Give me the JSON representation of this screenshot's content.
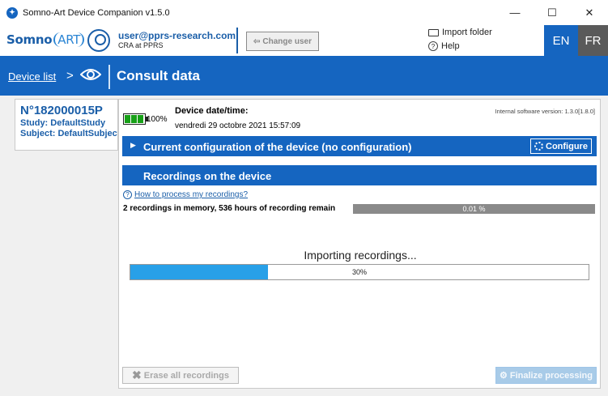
{
  "window": {
    "title": "Somno-Art Device Companion v1.5.0",
    "minimize_glyph": "—",
    "maximize_glyph": "☐",
    "close_glyph": "✕"
  },
  "header": {
    "logo_somno": "Somno",
    "logo_art": "ART",
    "user_email": "user@pprs-research.com",
    "user_role": "CRA at PPRS",
    "change_user_label": "Change user",
    "import_folder_label": "Import folder",
    "help_label": "Help",
    "lang_en": "EN",
    "lang_fr": "FR"
  },
  "breadcrumb": {
    "device_list": "Device list",
    "separator": ">",
    "title": "Consult data"
  },
  "device": {
    "number": "N°182000015P",
    "study": "Study: DefaultStudy",
    "subject": "Subject: DefaultSubject"
  },
  "status": {
    "battery_percent": "100%",
    "battery_level": 1.0,
    "datetime_label": "Device date/time:",
    "datetime_value": "vendredi 29 octobre 2021 15:57:09",
    "software_version": "Internal software version: 1.3.0[1.8.0]"
  },
  "config": {
    "label": "Current configuration of the device (no configuration)",
    "configure_label": "Configure"
  },
  "recordings": {
    "header": "Recordings on the device",
    "how_to_link": "How to process my recordings?",
    "memory_text": "2 recordings in memory, 536 hours of recording remain",
    "memory_percent": "0.01 %",
    "memory_fraction": 0.0001
  },
  "import": {
    "label": "Importing recordings...",
    "progress_text": "30%",
    "progress_fraction": 0.3
  },
  "actions": {
    "erase_label": "Erase all recordings",
    "finalize_label": "Finalize processing"
  },
  "colors": {
    "brand_blue": "#1565c0",
    "progress_blue": "#28a0e8",
    "battery_green": "#18a018",
    "lang_inactive": "#5a5a5a"
  },
  "icons": [
    "app-icon",
    "user-icon",
    "change-user-icon",
    "folder-icon",
    "help-icon",
    "eye-icon",
    "battery-icon",
    "gear-icon",
    "question-icon",
    "erase-icon",
    "finalize-icon"
  ]
}
